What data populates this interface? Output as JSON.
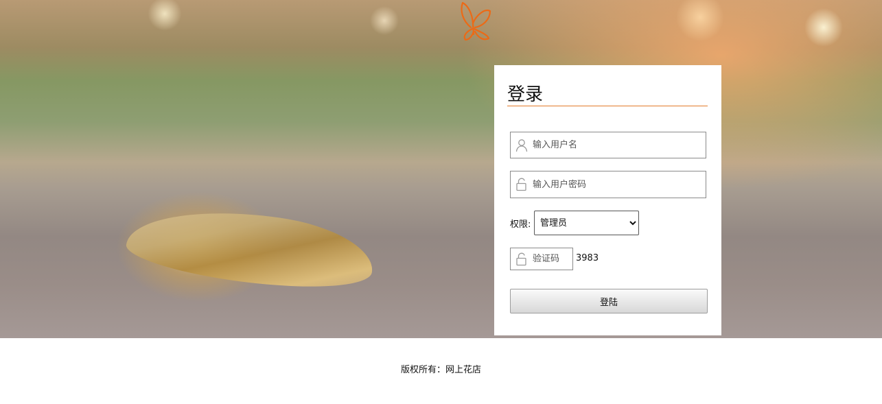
{
  "login": {
    "title": "登录",
    "username_placeholder": "输入用户名",
    "password_placeholder": "输入用户密码",
    "role_label": "权限:",
    "role_selected": "管理员",
    "captcha_placeholder": "验证码",
    "captcha_code": "3983",
    "submit_label": "登陆"
  },
  "footer": {
    "copyright": "版权所有：网上花店"
  },
  "icons": {
    "username": "user-icon",
    "password": "lock-icon",
    "captcha": "lock-icon",
    "logo": "butterfly-icon"
  },
  "colors": {
    "accent": "#e37a28"
  }
}
